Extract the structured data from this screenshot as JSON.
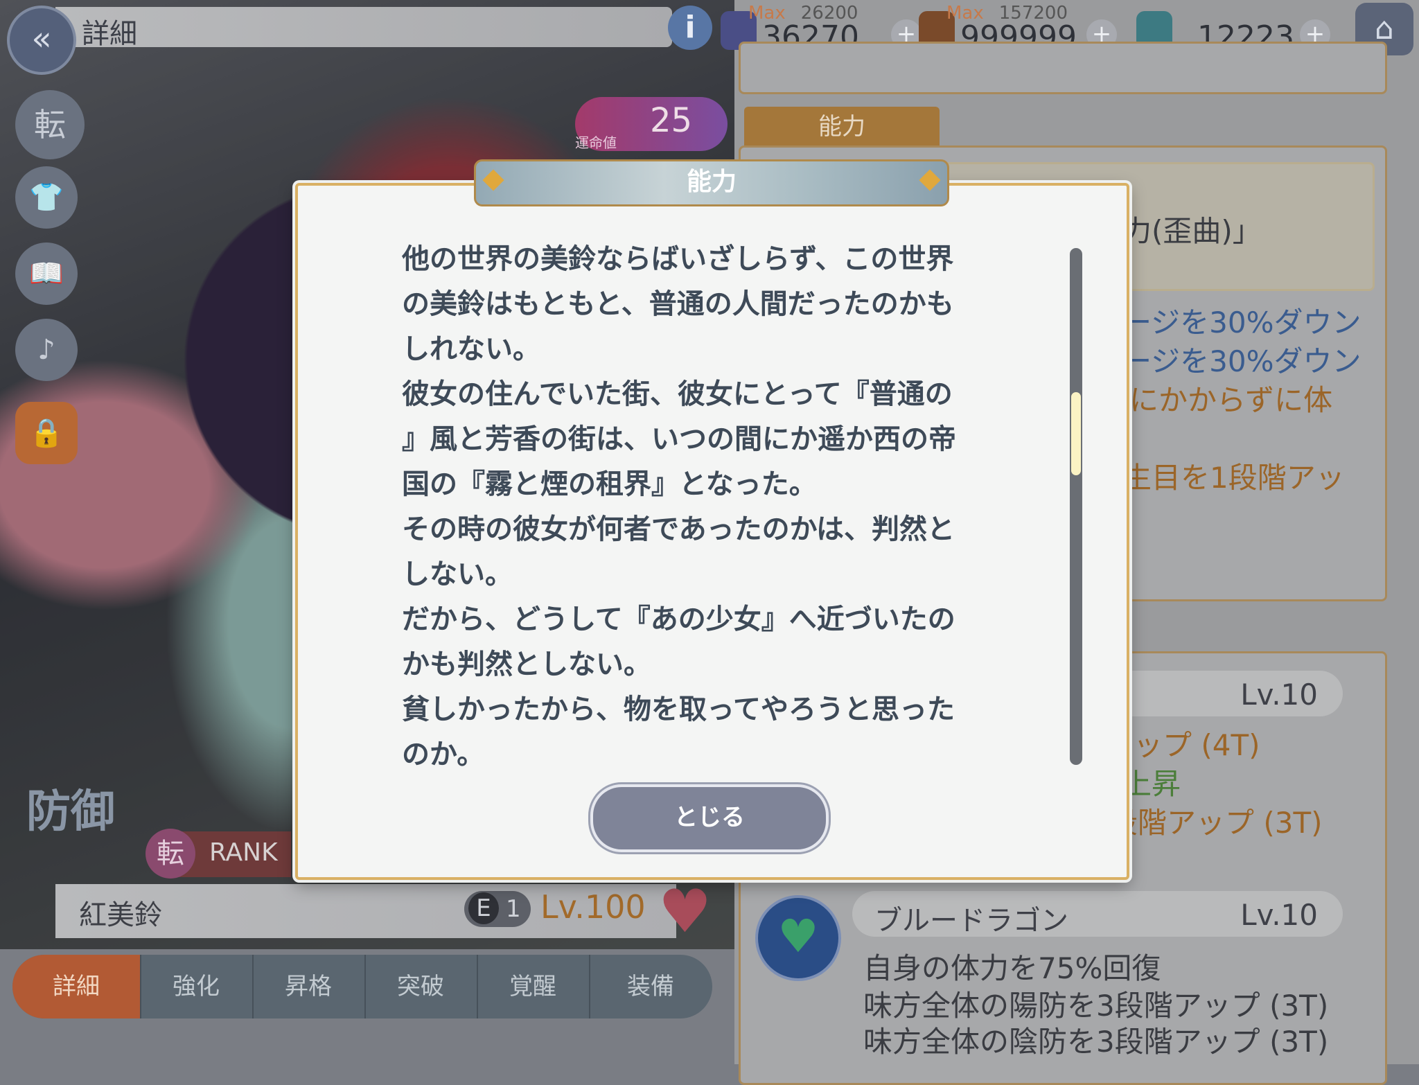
{
  "header": {
    "title": "詳細",
    "resources": [
      {
        "icon": "spirit-flame-icon",
        "max_label": "Max",
        "max_value": "26200",
        "value": "36270"
      },
      {
        "icon": "money-bag-icon",
        "max_label": "Max",
        "max_value": "157200",
        "value": "999999"
      },
      {
        "icon": "cube-icon",
        "value": "12223"
      }
    ]
  },
  "character": {
    "luck_label": "運命値",
    "luck_value": "25",
    "type_label": "防御",
    "rank_ten": "転",
    "rank_label": "RANK",
    "name": "紅美鈴",
    "e_label": "E",
    "e_value": "1",
    "level": "Lv.100"
  },
  "side": {
    "ten": "転"
  },
  "tabs": [
    "詳細",
    "強化",
    "昇格",
    "突破",
    "覚醒",
    "装備"
  ],
  "right_panel": {
    "tab_label": "能力",
    "ability_partial": "力(歪曲)」",
    "lines": [
      "ージを30%ダウン",
      "ージを30%ダウン",
      "にかからずに体",
      "生目を1段階アッ"
    ],
    "skill1": {
      "level": "Lv.10",
      "lines": [
        "アップ (4T)",
        "上昇",
        "段階アップ (3T)"
      ]
    },
    "skill2": {
      "name": "ブルードラゴン",
      "level": "Lv.10",
      "lines": [
        "自身の体力を75%回復",
        "味方全体の陽防を3段階アップ (3T)",
        "味方全体の陰防を3段階アップ (3T)"
      ]
    }
  },
  "modal": {
    "title": "能力",
    "paragraphs": [
      "他の世界の美鈴ならばいざしらず、この世界\nの美鈴はもともと、普通の人間だったのかも\nしれない。",
      "彼女の住んでいた街、彼女にとって『普通の\n』風と芳香の街は、いつの間にか遥か西の帝\n国の『霧と煙の租界』となった。",
      "その時の彼女が何者であったのかは、判然と\nしない。",
      "だから、どうして『あの少女』へ近づいたの\nかも判然としない。",
      "貧しかったから、物を取ってやろうと思った\nのか。"
    ],
    "close_label": "とじる"
  }
}
